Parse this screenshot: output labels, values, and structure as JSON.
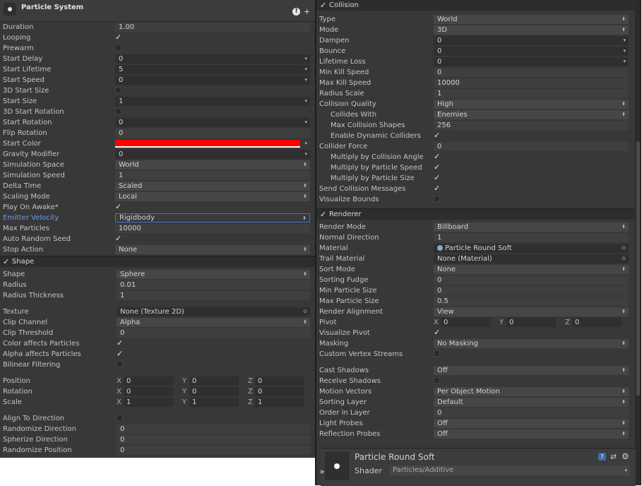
{
  "ps": {
    "title": "Particle System",
    "rows": [
      {
        "label": "Duration",
        "value": "1.00",
        "kind": "plain"
      },
      {
        "label": "Looping",
        "check": true
      },
      {
        "label": "Prewarm",
        "check": false
      },
      {
        "label": "Start Delay",
        "value": "0",
        "kind": "field",
        "arrow": true
      },
      {
        "label": "Start Lifetime",
        "value": "5",
        "kind": "field",
        "arrow": true
      },
      {
        "label": "Start Speed",
        "value": "0",
        "kind": "field",
        "arrow": true
      },
      {
        "label": "3D Start Size",
        "check": false
      },
      {
        "label": "Start Size",
        "value": "1",
        "kind": "field",
        "arrow": true
      },
      {
        "label": "3D Start Rotation",
        "check": false
      },
      {
        "label": "Start Rotation",
        "value": "0",
        "kind": "field",
        "arrow": true
      },
      {
        "label": "Flip Rotation",
        "value": "0",
        "kind": "plain"
      },
      {
        "label": "Start Color",
        "color": "#ff0000",
        "arrow": true
      },
      {
        "label": "Gravity Modifier",
        "value": "0",
        "kind": "field",
        "arrow": true
      },
      {
        "label": "Simulation Space",
        "value": "World",
        "kind": "drop",
        "drop": true
      },
      {
        "label": "Simulation Speed",
        "value": "1",
        "kind": "plain"
      },
      {
        "label": "Delta Time",
        "value": "Scaled",
        "kind": "drop",
        "drop": true
      },
      {
        "label": "Scaling Mode",
        "value": "Local",
        "kind": "drop",
        "drop": true
      },
      {
        "label": "Play On Awake*",
        "check": true
      },
      {
        "label": "Emitter Velocity",
        "value": "Rigidbody",
        "kind": "sel",
        "drop": true,
        "blue": true
      },
      {
        "label": "Max Particles",
        "value": "10000",
        "kind": "plain"
      },
      {
        "label": "Auto Random Seed",
        "check": true
      },
      {
        "label": "Stop Action",
        "value": "None",
        "kind": "drop",
        "drop": true
      }
    ]
  },
  "shape": {
    "header": "Shape",
    "rows1": [
      {
        "label": "Shape",
        "value": "Sphere",
        "kind": "drop",
        "drop": true
      },
      {
        "label": "Radius",
        "value": "0.01",
        "kind": "plain"
      },
      {
        "label": "Radius Thickness",
        "value": "1",
        "kind": "plain"
      }
    ],
    "rows2": [
      {
        "label": "Texture",
        "value": "None (Texture 2D)",
        "kind": "field",
        "obj": true
      },
      {
        "label": "Clip Channel",
        "value": "Alpha",
        "kind": "drop",
        "drop": true
      },
      {
        "label": "Clip Threshold",
        "value": "0",
        "kind": "plain"
      },
      {
        "label": "Color affects Particles",
        "check": true
      },
      {
        "label": "Alpha affects Particles",
        "check": true
      },
      {
        "label": "Bilinear Filtering",
        "check": false
      }
    ],
    "vec": [
      {
        "label": "Position",
        "x": "0",
        "y": "0",
        "z": "0"
      },
      {
        "label": "Rotation",
        "x": "0",
        "y": "0",
        "z": "0"
      },
      {
        "label": "Scale",
        "x": "1",
        "y": "1",
        "z": "1"
      }
    ],
    "rows3": [
      {
        "label": "Align To Direction",
        "check": false
      },
      {
        "label": "Randomize Direction",
        "value": "0",
        "kind": "plain"
      },
      {
        "label": "Spherize Direction",
        "value": "0",
        "kind": "plain"
      },
      {
        "label": "Randomize Position",
        "value": "0",
        "kind": "plain"
      }
    ]
  },
  "collision": {
    "header": "Collision",
    "rows": [
      {
        "label": "Type",
        "value": "World",
        "kind": "drop",
        "drop": true
      },
      {
        "label": "Mode",
        "value": "3D",
        "kind": "drop",
        "drop": true
      },
      {
        "label": "Dampen",
        "value": "0",
        "kind": "field",
        "arrow": true
      },
      {
        "label": "Bounce",
        "value": "0",
        "kind": "field",
        "arrow": true
      },
      {
        "label": "Lifetime Loss",
        "value": "0",
        "kind": "field",
        "arrow": true
      },
      {
        "label": "Min Kill Speed",
        "value": "0",
        "kind": "plain"
      },
      {
        "label": "Max Kill Speed",
        "value": "10000",
        "kind": "plain"
      },
      {
        "label": "Radius Scale",
        "value": "1",
        "kind": "plain"
      },
      {
        "label": "Collision Quality",
        "value": "High",
        "kind": "drop",
        "drop": true
      },
      {
        "label": "Collides With",
        "value": "Enemies",
        "kind": "drop",
        "drop": true,
        "ind": true
      },
      {
        "label": "Max Collision Shapes",
        "value": "256",
        "kind": "plain",
        "ind": true
      },
      {
        "label": "Enable Dynamic Colliders",
        "check": true,
        "ind": true
      },
      {
        "label": "Collider Force",
        "value": "0",
        "kind": "plain"
      },
      {
        "label": "Multiply by Collision Angle",
        "check": true,
        "ind": true
      },
      {
        "label": "Multiply by Particle Speed",
        "check": true,
        "ind": true
      },
      {
        "label": "Multiply by Particle Size",
        "check": true,
        "ind": true
      },
      {
        "label": "Send Collision Messages",
        "check": true
      },
      {
        "label": "Visualize Bounds",
        "check": false
      }
    ]
  },
  "renderer": {
    "header": "Renderer",
    "rows1": [
      {
        "label": "Render Mode",
        "value": "Billboard",
        "kind": "drop",
        "drop": true
      },
      {
        "label": "Normal Direction",
        "value": "1",
        "kind": "plain"
      },
      {
        "label": "Material",
        "value": "Particle Round Soft",
        "kind": "field",
        "obj": true,
        "ball": true
      },
      {
        "label": "Trail Material",
        "value": "None (Material)",
        "kind": "field",
        "obj": true
      },
      {
        "label": "Sort Mode",
        "value": "None",
        "kind": "drop",
        "drop": true
      },
      {
        "label": "Sorting Fudge",
        "value": "0",
        "kind": "plain"
      },
      {
        "label": "Min Particle Size",
        "value": "0",
        "kind": "plain"
      },
      {
        "label": "Max Particle Size",
        "value": "0.5",
        "kind": "plain"
      },
      {
        "label": "Render Alignment",
        "value": "View",
        "kind": "drop",
        "drop": true
      }
    ],
    "pivot": {
      "label": "Pivot",
      "x": "0",
      "y": "0",
      "z": "0"
    },
    "rows2": [
      {
        "label": "Visualize Pivot",
        "check": true
      },
      {
        "label": "Masking",
        "value": "No Masking",
        "kind": "drop",
        "drop": true
      },
      {
        "label": "Custom Vertex Streams",
        "check": false
      }
    ],
    "rows3": [
      {
        "label": "Cast Shadows",
        "value": "Off",
        "kind": "drop",
        "drop": true
      },
      {
        "label": "Receive Shadows",
        "check": false
      },
      {
        "label": "Motion Vectors",
        "value": "Per Object Motion",
        "kind": "drop",
        "drop": true
      },
      {
        "label": "Sorting Layer",
        "value": "Default",
        "kind": "drop",
        "drop": true
      },
      {
        "label": "Order in Layer",
        "value": "0",
        "kind": "plain"
      },
      {
        "label": "Light Probes",
        "value": "Off",
        "kind": "drop",
        "drop": true
      },
      {
        "label": "Reflection Probes",
        "value": "Off",
        "kind": "drop",
        "drop": true
      }
    ]
  },
  "material": {
    "name": "Particle Round Soft",
    "shader_label": "Shader",
    "shader_value": "Particles/Additive"
  },
  "axes": {
    "x": "X",
    "y": "Y",
    "z": "Z"
  },
  "glyphs": {
    "check": "✓",
    "drop": "⬍",
    "arrow": "▾",
    "obj": "⊙"
  }
}
